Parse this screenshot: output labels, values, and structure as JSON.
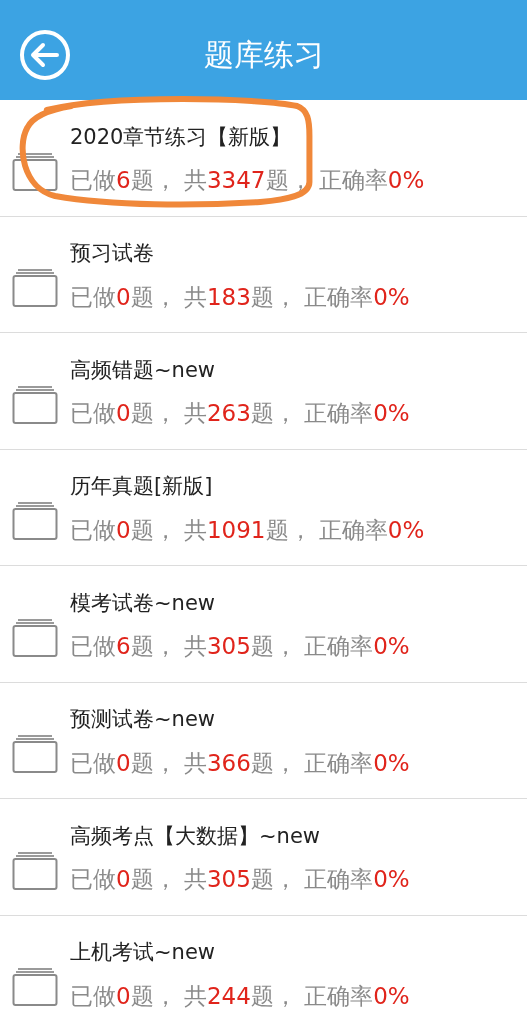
{
  "header": {
    "title": "题库练习"
  },
  "items": [
    {
      "title": "2020章节练习【新版】",
      "highlighted": true,
      "stats": [
        {
          "kind": "label",
          "text": "已做"
        },
        {
          "kind": "number",
          "text": "6"
        },
        {
          "kind": "label",
          "text": "题， 共"
        },
        {
          "kind": "number",
          "text": "3347"
        },
        {
          "kind": "label",
          "text": "题， 正确率"
        },
        {
          "kind": "number",
          "text": "0%"
        }
      ]
    },
    {
      "title": "预习试卷",
      "highlighted": false,
      "stats": [
        {
          "kind": "label",
          "text": "已做"
        },
        {
          "kind": "number",
          "text": "0"
        },
        {
          "kind": "label",
          "text": "题， 共"
        },
        {
          "kind": "number",
          "text": "183"
        },
        {
          "kind": "label",
          "text": "题， 正确率"
        },
        {
          "kind": "number",
          "text": "0%"
        }
      ]
    },
    {
      "title": "高频错题~new",
      "highlighted": false,
      "stats": [
        {
          "kind": "label",
          "text": "已做"
        },
        {
          "kind": "number",
          "text": "0"
        },
        {
          "kind": "label",
          "text": "题， 共"
        },
        {
          "kind": "number",
          "text": "263"
        },
        {
          "kind": "label",
          "text": "题， 正确率"
        },
        {
          "kind": "number",
          "text": "0%"
        }
      ]
    },
    {
      "title": "历年真题[新版]",
      "highlighted": false,
      "stats": [
        {
          "kind": "label",
          "text": "已做"
        },
        {
          "kind": "number",
          "text": "0"
        },
        {
          "kind": "label",
          "text": "题， 共"
        },
        {
          "kind": "number",
          "text": "1091"
        },
        {
          "kind": "label",
          "text": "题， 正确率"
        },
        {
          "kind": "number",
          "text": "0%"
        }
      ]
    },
    {
      "title": "模考试卷~new",
      "highlighted": false,
      "stats": [
        {
          "kind": "label",
          "text": "已做"
        },
        {
          "kind": "number",
          "text": "6"
        },
        {
          "kind": "label",
          "text": "题， 共"
        },
        {
          "kind": "number",
          "text": "305"
        },
        {
          "kind": "label",
          "text": "题， 正确率"
        },
        {
          "kind": "number",
          "text": "0%"
        }
      ]
    },
    {
      "title": "预测试卷~new",
      "highlighted": false,
      "stats": [
        {
          "kind": "label",
          "text": "已做"
        },
        {
          "kind": "number",
          "text": "0"
        },
        {
          "kind": "label",
          "text": "题， 共"
        },
        {
          "kind": "number",
          "text": "366"
        },
        {
          "kind": "label",
          "text": "题， 正确率"
        },
        {
          "kind": "number",
          "text": "0%"
        }
      ]
    },
    {
      "title": "高频考点【大数据】~new",
      "highlighted": false,
      "stats": [
        {
          "kind": "label",
          "text": "已做"
        },
        {
          "kind": "number",
          "text": "0"
        },
        {
          "kind": "label",
          "text": "题， 共"
        },
        {
          "kind": "number",
          "text": "305"
        },
        {
          "kind": "label",
          "text": "题， 正确率"
        },
        {
          "kind": "number",
          "text": "0%"
        }
      ]
    },
    {
      "title": "上机考试~new",
      "highlighted": false,
      "stats": [
        {
          "kind": "label",
          "text": "已做"
        },
        {
          "kind": "number",
          "text": "0"
        },
        {
          "kind": "label",
          "text": "题， 共"
        },
        {
          "kind": "number",
          "text": "244"
        },
        {
          "kind": "label",
          "text": "题， 正确率"
        },
        {
          "kind": "number",
          "text": "0%"
        }
      ]
    }
  ]
}
